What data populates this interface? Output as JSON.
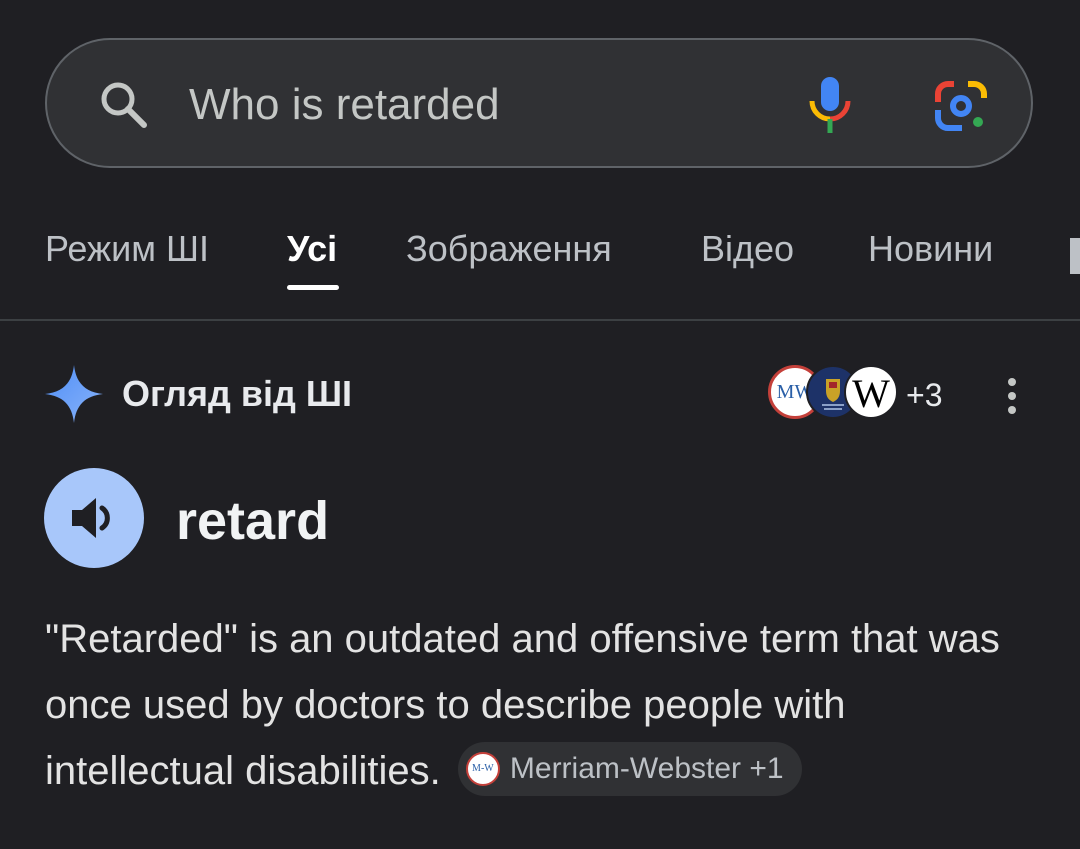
{
  "search": {
    "query": "Who is retarded"
  },
  "tabs": [
    {
      "label": "Режим ШІ",
      "active": false
    },
    {
      "label": "Усі",
      "active": true
    },
    {
      "label": "Зображення",
      "active": false
    },
    {
      "label": "Відео",
      "active": false
    },
    {
      "label": "Новини",
      "active": false
    }
  ],
  "ai_overview": {
    "title": "Огляд від ШІ",
    "sources": [
      {
        "name": "Merriam-Webster",
        "logo_text": "MW"
      },
      {
        "name": "Cambridge Dictionary",
        "logo_text": ""
      },
      {
        "name": "Wikipedia",
        "logo_text": "W"
      }
    ],
    "more_sources": "+3"
  },
  "term": {
    "word": "retard"
  },
  "definition": {
    "text": "\"Retarded\" is an outdated and offensive term that was once used by doctors to describe people with intellectual disabilities.",
    "chip_logo": "M-W",
    "chip_label": "Merriam-Webster +1"
  },
  "colors": {
    "background": "#1f1f23",
    "search_bg": "#303134",
    "accent_blue": "#a8c7fa",
    "google_blue": "#4285f4",
    "google_red": "#ea4335",
    "google_yellow": "#fbbc04",
    "google_green": "#34a853"
  }
}
